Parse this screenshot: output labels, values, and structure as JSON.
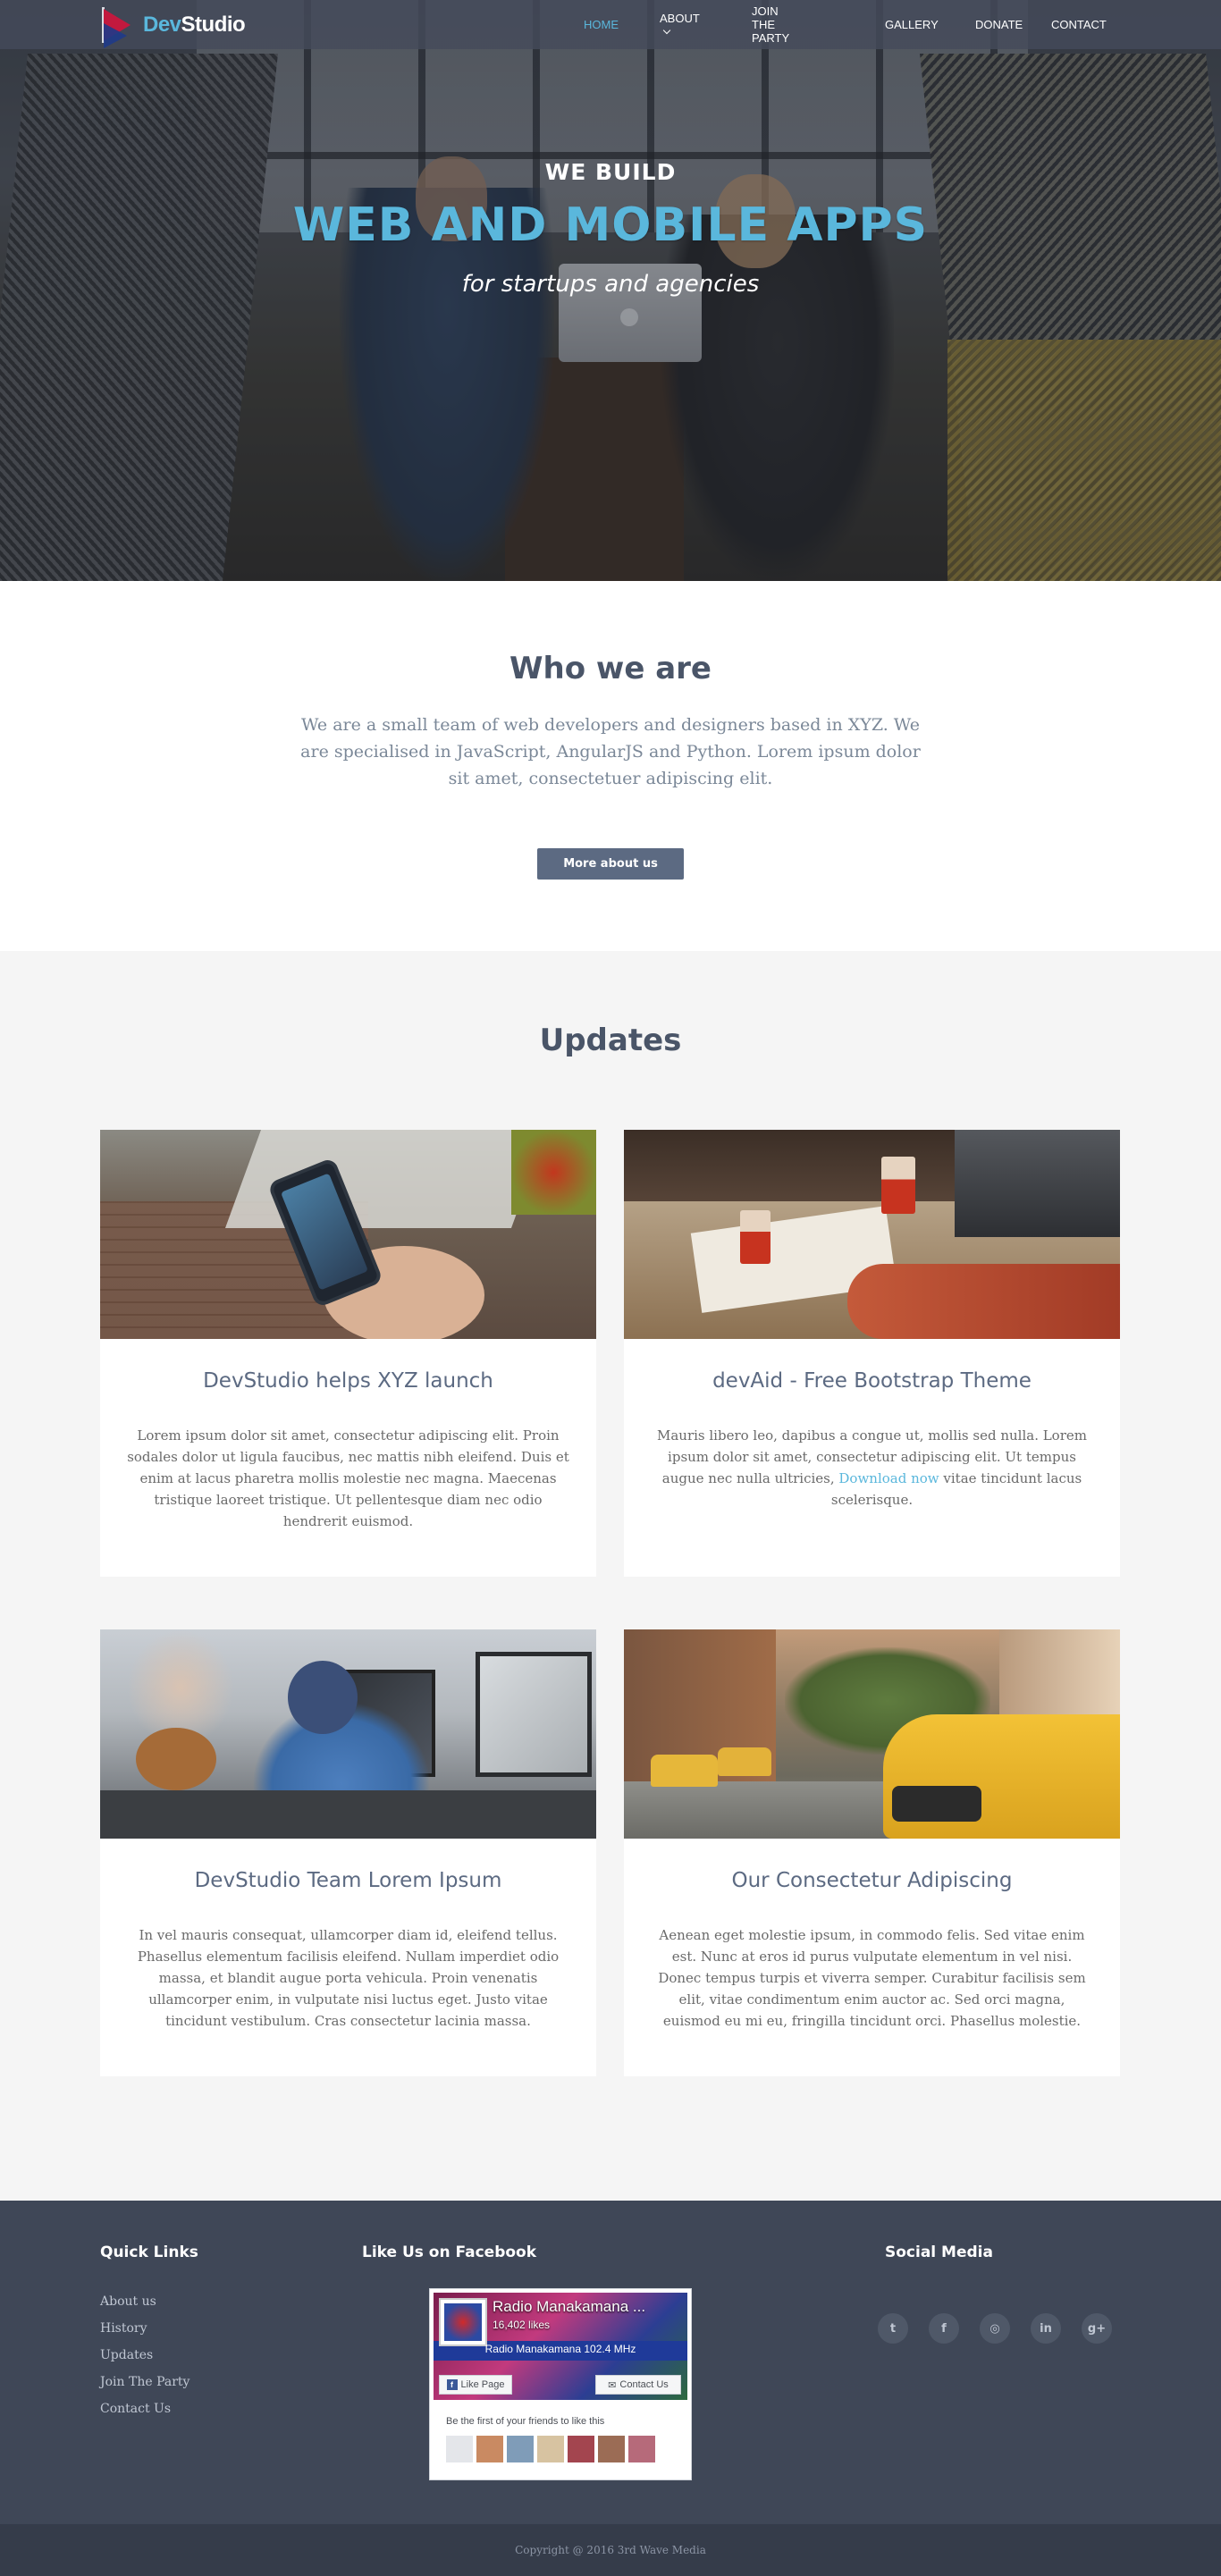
{
  "nav": {
    "logo_prefix": "Dev",
    "logo_suffix": "Studio",
    "items": [
      {
        "label": "HOME",
        "active": true
      },
      {
        "label": "ABOUT",
        "has_dropdown": true
      },
      {
        "label": "JOIN THE PARTY"
      },
      {
        "label": "GALLERY"
      },
      {
        "label": "DONATE"
      },
      {
        "label": "CONTACT"
      }
    ]
  },
  "hero": {
    "sub": "WE BUILD",
    "title": "WEB AND MOBILE APPS",
    "tagline": "for startups and agencies"
  },
  "who": {
    "title": "Who we are",
    "text": "We are a small team of web developers and designers based in XYZ. We are specialised in JavaScript, AngularJS and Python. Lorem ipsum dolor sit amet, consectetuer adipiscing elit.",
    "button": "More about us"
  },
  "updates": {
    "title": "Updates",
    "cards": [
      {
        "title": "DevStudio helps XYZ launch",
        "text": "Lorem ipsum dolor sit amet, consectetur adipiscing elit. Proin sodales dolor ut ligula faucibus, nec mattis nibh eleifend. Duis et enim at lacus pharetra mollis molestie nec magna. Maecenas tristique laoreet tristique. Ut pellentesque diam nec odio hendrerit euismod."
      },
      {
        "title": "devAid - Free Bootstrap Theme",
        "text_before": "Mauris libero leo, dapibus a congue ut, mollis sed nulla. Lorem ipsum dolor sit amet, consectetur adipiscing elit. Ut tempus augue nec nulla ultricies, ",
        "link": "Download now",
        "text_after": " vitae tincidunt lacus scelerisque."
      },
      {
        "title": "DevStudio Team Lorem Ipsum",
        "text": "In vel mauris consequat, ullamcorper diam id, eleifend tellus. Phasellus elementum facilisis eleifend. Nullam imperdiet odio massa, et blandit augue porta vehicula. Proin venenatis ullamcorper enim, in vulputate nisi luctus eget. Justo vitae tincidunt vestibulum. Cras consectetur lacinia massa."
      },
      {
        "title": "Our Consectetur Adipiscing",
        "text": "Aenean eget molestie ipsum, in commodo felis. Sed vitae enim est. Nunc at eros id purus vulputate elementum in vel nisi. Donec tempus turpis et viverra semper. Curabitur facilisis sem elit, vitae condimentum enim auctor ac. Sed orci magna, euismod eu mi eu, fringilla tincidunt orci. Phasellus molestie."
      }
    ]
  },
  "footer": {
    "quick_links_title": "Quick Links",
    "quick_links": [
      "About us",
      "History",
      "Updates",
      "Join The Party",
      "Contact Us"
    ],
    "facebook_title": "Like Us on Facebook",
    "facebook": {
      "page_name": "Radio Manakamana ...",
      "likes": "16,402 likes",
      "band_text": "Radio Manakamana 102.4 MHz",
      "like_button": "Like Page",
      "contact_button": "Contact Us",
      "friends_text": "Be the first of your friends to like this"
    },
    "social_title": "Social Media",
    "social": [
      {
        "icon": "twitter-icon",
        "glyph": "t"
      },
      {
        "icon": "facebook-icon",
        "glyph": "f"
      },
      {
        "icon": "instagram-icon",
        "glyph": "◎"
      },
      {
        "icon": "linkedin-icon",
        "glyph": "in"
      },
      {
        "icon": "google-plus-icon",
        "glyph": "g+"
      }
    ]
  },
  "copyright": "Copyright @ 2016 3rd Wave Media"
}
